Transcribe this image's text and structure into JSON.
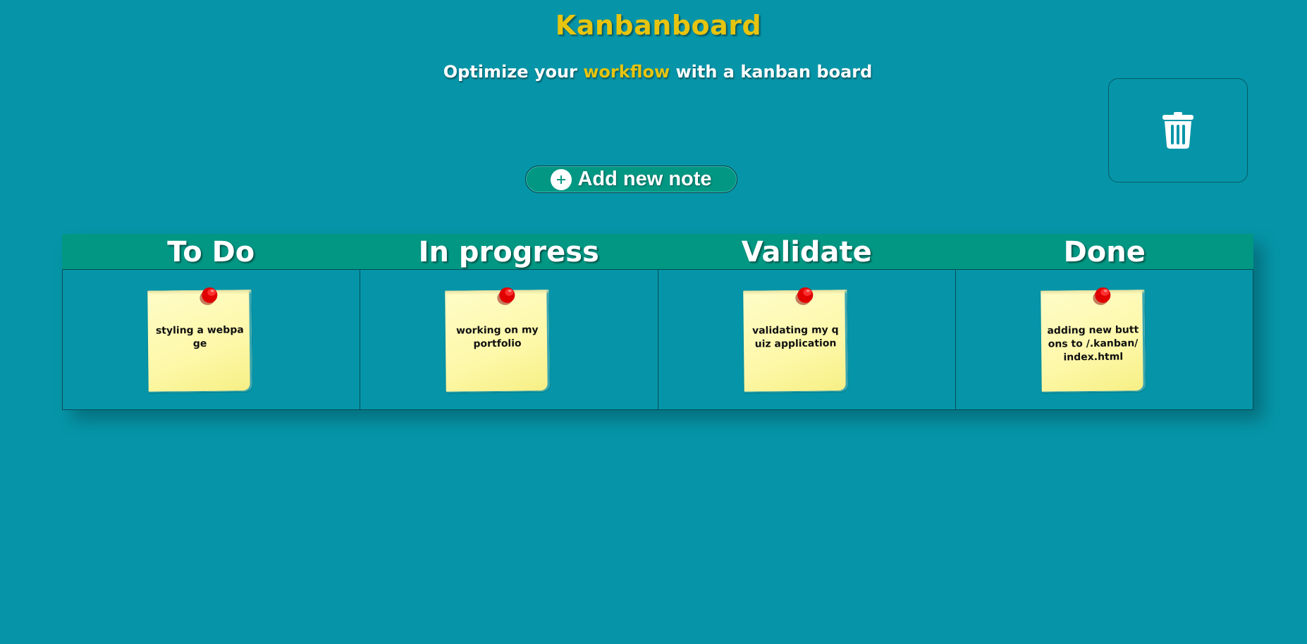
{
  "header": {
    "title": "Kanbanboard",
    "subtitle_before": "Optimize your ",
    "subtitle_highlight": "workflow",
    "subtitle_after": " with a kanban board"
  },
  "toolbar": {
    "add_note_label": "Add new note"
  },
  "board": {
    "columns": [
      {
        "title": "To Do",
        "note": "styling a webpage"
      },
      {
        "title": "In progress",
        "note": "working on my portfolio"
      },
      {
        "title": "Validate",
        "note": "validating my quiz application"
      },
      {
        "title": "Done",
        "note": "adding new buttons to /.kanban/index.html"
      }
    ]
  },
  "icons": {
    "trash": "trash-icon",
    "plus": "plus-circle-icon",
    "pin": "pushpin-icon"
  },
  "colors": {
    "background": "#0695a8",
    "accent_yellow": "#e6c40f",
    "header_green": "#019783",
    "note_yellow": "#fdf8a8",
    "pin_red": "#e00000"
  }
}
